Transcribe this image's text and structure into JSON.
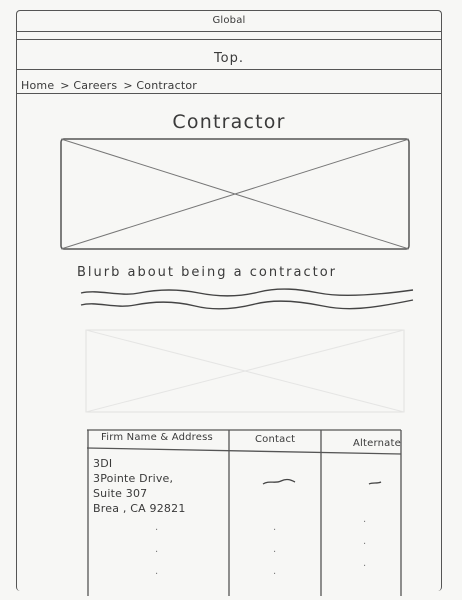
{
  "header": {
    "global_label": "Global",
    "top_label": "Top."
  },
  "breadcrumb": {
    "items": [
      "Home",
      "> Careers",
      "> Contractor"
    ]
  },
  "page_title": "Contractor",
  "blurb": "Blurb about being a contractor",
  "table": {
    "headers": [
      "Firm Name & Address",
      "Contact",
      "Alternate"
    ],
    "first_row": {
      "address_lines": [
        "3DI",
        "3Pointe Drive,",
        "Suite 307",
        "Brea , CA 92821"
      ]
    }
  }
}
